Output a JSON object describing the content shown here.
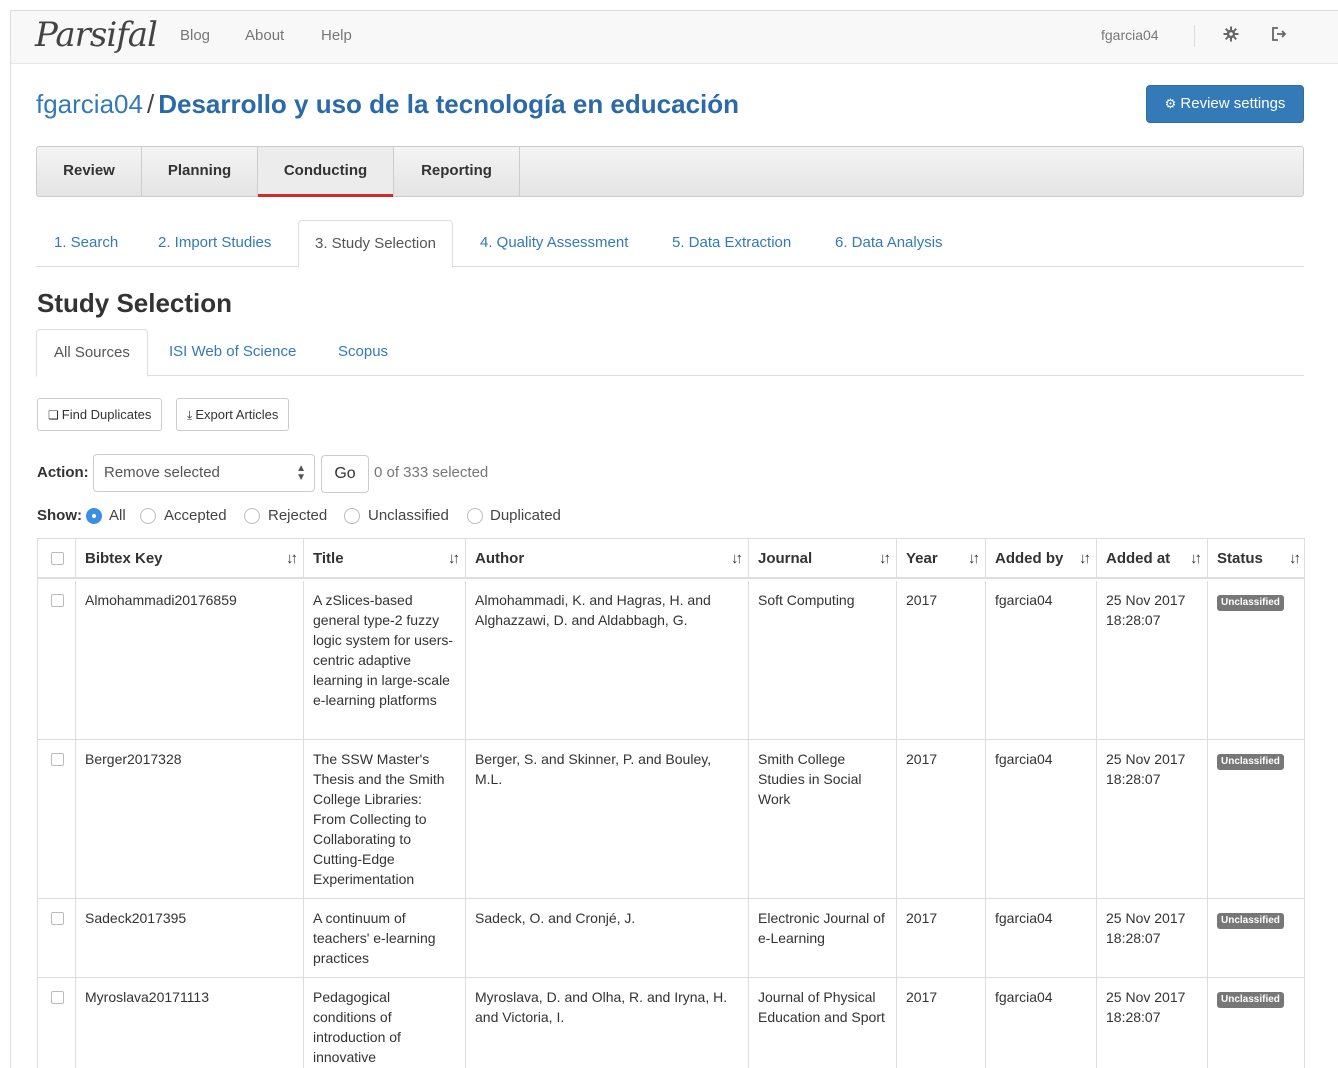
{
  "navbar": {
    "brand": "Parsifal",
    "links": [
      "Blog",
      "About",
      "Help"
    ],
    "user": "fgarcia04",
    "settings_icon": "gear-icon",
    "logout_icon": "sign-out-icon"
  },
  "header": {
    "user": "fgarcia04",
    "separator": "/",
    "project": "Desarrollo y uso de la tecnología en educación",
    "review_settings_icon": "gear-icon",
    "review_settings_label": "Review settings"
  },
  "main_tabs": [
    "Review",
    "Planning",
    "Conducting",
    "Reporting"
  ],
  "sub_tabs": [
    "1. Search",
    "2. Import Studies",
    "3. Study Selection",
    "4. Quality Assessment",
    "5. Data Extraction",
    "6. Data Analysis"
  ],
  "section_title": "Study Selection",
  "source_tabs": [
    "All Sources",
    "ISI Web of Science",
    "Scopus"
  ],
  "toolbar": {
    "find_duplicates": "Find Duplicates",
    "export_articles": "Export Articles"
  },
  "action": {
    "label": "Action:",
    "selected": "Remove selected",
    "go": "Go",
    "count": "0 of 333 selected"
  },
  "show": {
    "label": "Show:",
    "options": [
      "All",
      "Accepted",
      "Rejected",
      "Unclassified",
      "Duplicated"
    ],
    "selected": "All"
  },
  "table": {
    "columns": [
      "Bibtex Key",
      "Title",
      "Author",
      "Journal",
      "Year",
      "Added by",
      "Added at",
      "Status"
    ],
    "rows": [
      {
        "key": "Almohammadi20176859",
        "title": "A zSlices-based general type-2 fuzzy logic system for users-centric adaptive learning in large-scale e-learning platforms",
        "author": "Almohammadi, K. and Hagras, H. and Alghazzawi, D. and Aldabbagh, G.",
        "journal": "Soft Computing",
        "year": "2017",
        "added_by": "fgarcia04",
        "added_at": "25 Nov 2017 18:28:07",
        "status": "Unclassified"
      },
      {
        "key": "Berger2017328",
        "title": "The SSW Master's Thesis and the Smith College Libraries: From Collecting to Collaborating to Cutting-Edge Experimentation",
        "author": "Berger, S. and Skinner, P. and Bouley, M.L.",
        "journal": "Smith College Studies in Social Work",
        "year": "2017",
        "added_by": "fgarcia04",
        "added_at": "25 Nov 2017 18:28:07",
        "status": "Unclassified"
      },
      {
        "key": "Sadeck2017395",
        "title": "A continuum of teachers' e-learning practices",
        "author": "Sadeck, O. and Cronjé, J.",
        "journal": "Electronic Journal of e-Learning",
        "year": "2017",
        "added_by": "fgarcia04",
        "added_at": "25 Nov 2017 18:28:07",
        "status": "Unclassified"
      },
      {
        "key": "Myroslava20171113",
        "title": "Pedagogical conditions of introduction of innovative",
        "author": "Myroslava, D. and Olha, R. and Iryna, H. and Victoria, I.",
        "journal": "Journal of Physical Education and Sport",
        "year": "2017",
        "added_by": "fgarcia04",
        "added_at": "25 Nov 2017 18:28:07",
        "status": "Unclassified"
      }
    ]
  },
  "colors": {
    "link": "#337ab7",
    "primary": "#337ab7",
    "active_tab_underline": "#c9302c",
    "badge": "#777777",
    "radio_checked": "#3a8ee6"
  }
}
